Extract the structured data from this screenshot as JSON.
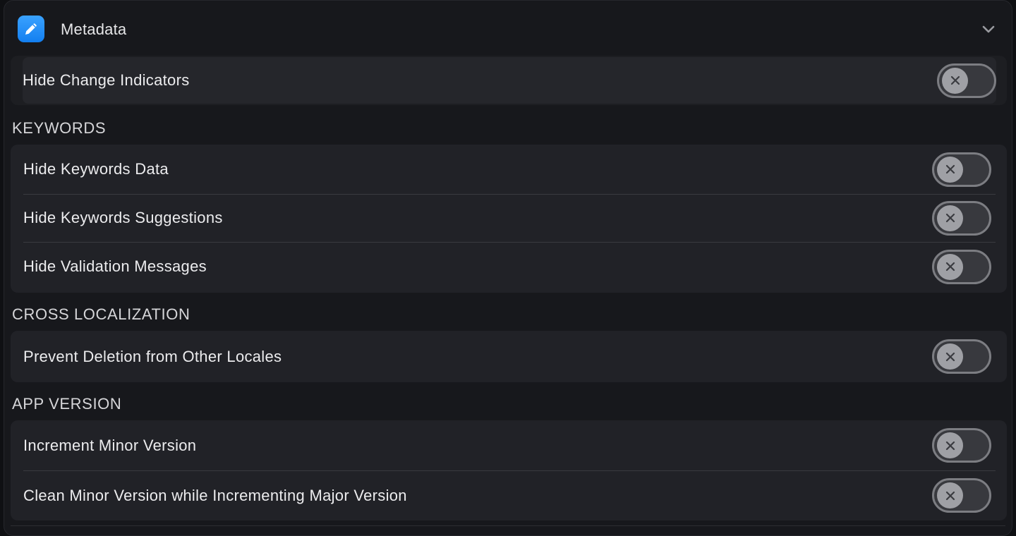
{
  "header": {
    "title": "Metadata",
    "icon": "pencil-icon",
    "chevron_icon": "chevron-down-icon",
    "accent_color": "#1e8cf6"
  },
  "top_group": {
    "items": [
      {
        "label": "Hide Change Indicators",
        "enabled": false
      }
    ]
  },
  "sections": [
    {
      "title": "KEYWORDS",
      "items": [
        {
          "label": "Hide Keywords Data",
          "enabled": false
        },
        {
          "label": "Hide Keywords Suggestions",
          "enabled": false
        },
        {
          "label": "Hide Validation Messages",
          "enabled": false
        }
      ]
    },
    {
      "title": "CROSS LOCALIZATION",
      "items": [
        {
          "label": "Prevent Deletion from Other Locales",
          "enabled": false
        }
      ]
    },
    {
      "title": "APP VERSION",
      "items": [
        {
          "label": "Increment Minor Version",
          "enabled": false
        },
        {
          "label": "Clean Minor Version while Incrementing Major Version",
          "enabled": false
        }
      ]
    }
  ],
  "toggle_icon": "x-mark-icon"
}
